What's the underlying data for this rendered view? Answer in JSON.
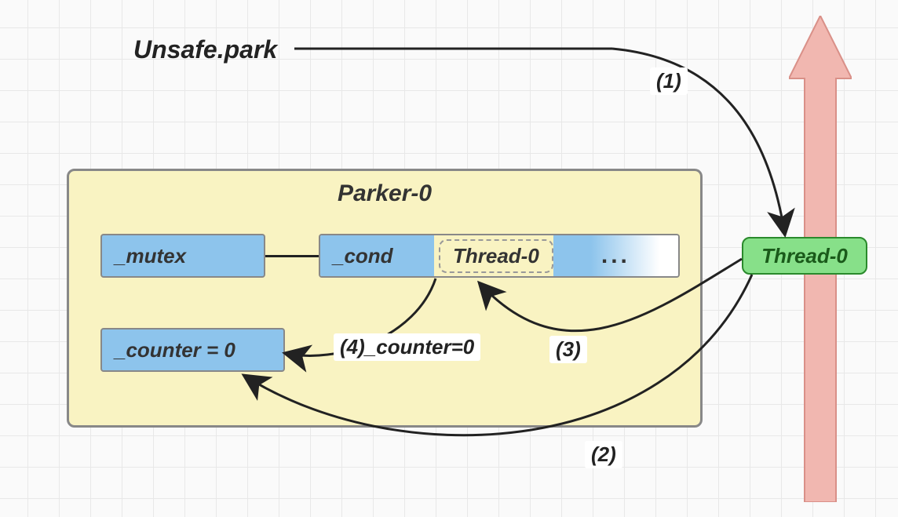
{
  "title": "Unsafe.park",
  "parker": {
    "name": "Parker-0",
    "mutex": "_mutex",
    "cond": "_cond",
    "cond_thread": "Thread-0",
    "cond_more": "...",
    "counter": "_counter = 0"
  },
  "thread": "Thread-0",
  "steps": {
    "s1": "(1)",
    "s2": "(2)",
    "s3": "(3)",
    "s4": "(4)_counter=0"
  },
  "colors": {
    "parker_bg": "#f9f3c2",
    "box_bg": "#8dc4ec",
    "thread_bg": "#87e089",
    "arrow_big": "#f1b7b0"
  }
}
